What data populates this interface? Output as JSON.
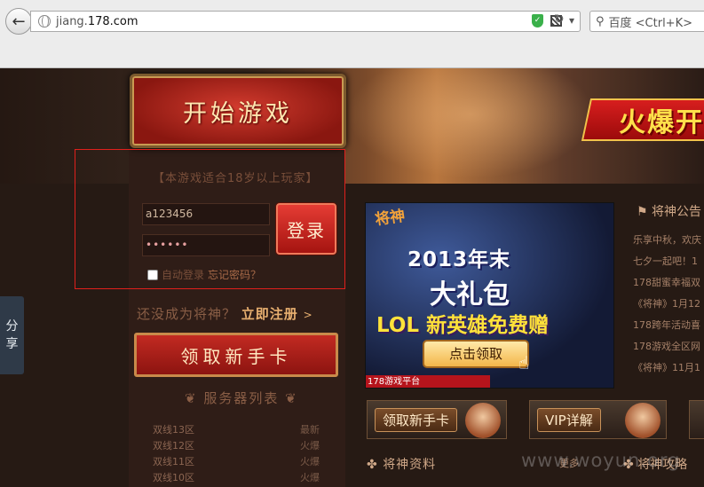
{
  "browser": {
    "url_prefix": "jiang.",
    "url_domain": "178.com",
    "search_placeholder": "百度 <Ctrl+K>"
  },
  "banner": {
    "start_label": "开始游戏",
    "promo_text": "火爆开"
  },
  "login": {
    "age_notice": "【本游戏适合18岁以上玩家】",
    "username": "a123456",
    "password_mask": "••••••",
    "login_label": "登录",
    "remember_label": "自动登录",
    "forgot_label": "忘记密码？"
  },
  "register": {
    "prompt": "还没成为将神？",
    "link": "立即注册",
    "arrow": ">"
  },
  "newbie_card_label": "领取新手卡",
  "servers": {
    "title": "服务器列表",
    "rows": [
      {
        "name": "双线13区",
        "status": "最新"
      },
      {
        "name": "双线12区",
        "status": "火爆"
      },
      {
        "name": "双线11区",
        "status": "火爆"
      },
      {
        "name": "双线10区",
        "status": "火爆"
      }
    ]
  },
  "share_label": [
    "分",
    "享"
  ],
  "promo": {
    "logo": "将神",
    "year": "2013年末",
    "gift": "大礼包",
    "lol_prefix": "LOL",
    "lol_hero": "新英雄",
    "lol_free": "免费赠",
    "claim": "点击领取",
    "platform": "178游戏平台"
  },
  "pills": {
    "newbie": "领取新手卡",
    "vip": "VIP详解"
  },
  "sections": {
    "data_title": "将神资料",
    "more": "更多",
    "guide_title": "将神攻略"
  },
  "news": {
    "title": "将神公告",
    "items": [
      "乐享中秋，欢庆",
      "七夕一起吧！1",
      "178甜蜜幸福双",
      "《将神》1月12",
      "178跨年活动喜",
      "178游戏全区网",
      "《将神》11月1"
    ]
  },
  "watermark": "www.woyun.org"
}
